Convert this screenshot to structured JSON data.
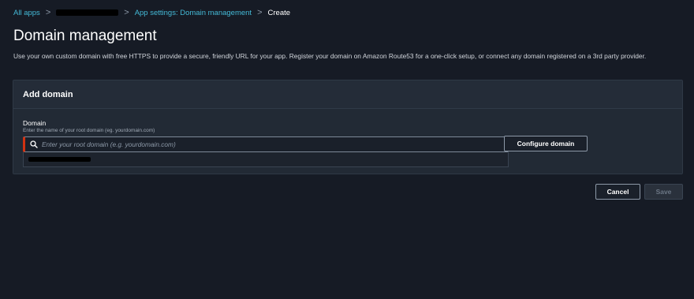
{
  "breadcrumb": {
    "all_apps": "All apps",
    "app_settings": "App settings: Domain management",
    "current": "Create",
    "separator": ">"
  },
  "page": {
    "title": "Domain management",
    "description": "Use your own custom domain with free HTTPS to provide a secure, friendly URL for your app. Register your domain on Amazon Route53 for a one-click setup, or connect any domain registered on a 3rd party provider."
  },
  "panel": {
    "header": "Add domain",
    "domain_label": "Domain",
    "domain_hint": "Enter the name of your root domain (eg. yourdomain.com)",
    "domain_placeholder": "Enter your root domain (e.g. yourdomain.com)",
    "domain_value": "",
    "configure_button": "Configure domain"
  },
  "actions": {
    "cancel": "Cancel",
    "save": "Save"
  },
  "colors": {
    "background": "#161b25",
    "link": "#44b9d6",
    "error_accent": "#d13212"
  },
  "icons": {
    "search": "search-icon"
  }
}
